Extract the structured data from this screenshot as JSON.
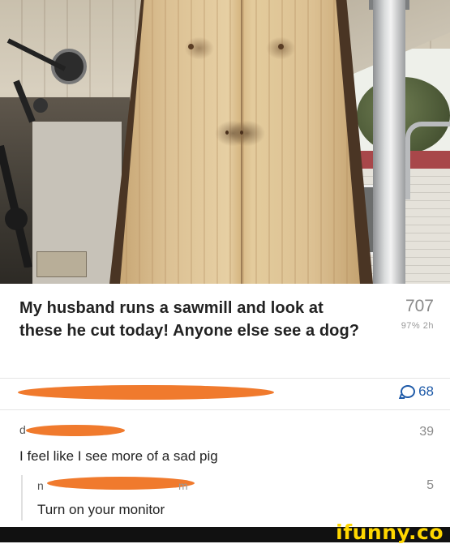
{
  "post": {
    "title": "My husband runs a sawmill and look at these he cut today! Anyone else see a dog?",
    "score": "707",
    "meta": "97% 2h"
  },
  "comments_bar": {
    "count": "68",
    "icon": "comment-bubble-icon"
  },
  "comments": [
    {
      "prefix": "d",
      "score": "39",
      "text": "I feel like I see more of a sad pig"
    },
    {
      "prefix": "n",
      "suffix": "m",
      "score": "5",
      "text": "Turn on your monitor"
    }
  ],
  "brand": {
    "logo": "ifunny.co",
    "logo_color": "#ffd700"
  },
  "colors": {
    "redaction": "#f07a2d",
    "accent": "#1e5aa8"
  }
}
